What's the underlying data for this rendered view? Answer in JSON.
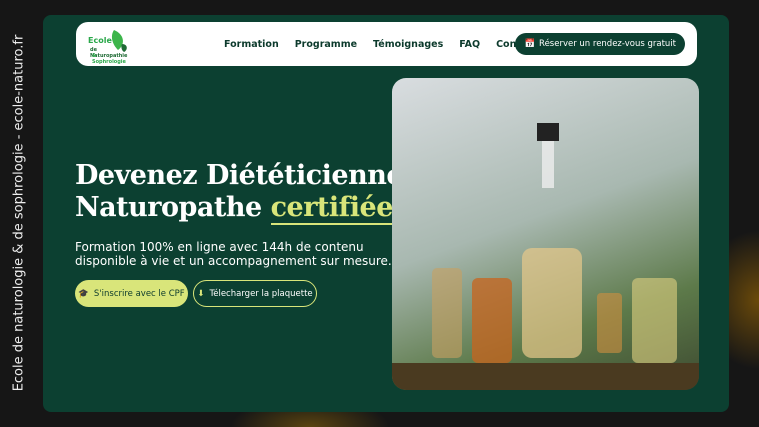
{
  "side_caption": "Ecole de naturologie & de sophrologie - ecole-naturo.fr",
  "logo": {
    "line1": "Ecole",
    "line2": "de Naturopathie",
    "line3": "& Sophrologie"
  },
  "nav": {
    "links": [
      "Formation",
      "Programme",
      "Témoignages",
      "FAQ",
      "Contact"
    ],
    "cta": "Réserver un rendez-vous gratuit"
  },
  "hero": {
    "title_line1": "Devenez Diététicienne",
    "title_line2": "Naturopathe",
    "title_highlight": "certifiée",
    "subtitle_line1": "Formation 100% en ligne avec 144h de contenu",
    "subtitle_line2": "disponible à vie et un accompagnement sur mesure.",
    "btn_cpf": "S'inscrire avec le CPF",
    "btn_download": "Télecharger la plaquette"
  },
  "colors": {
    "bg": "#0c4031",
    "accent": "#d9e57a"
  }
}
